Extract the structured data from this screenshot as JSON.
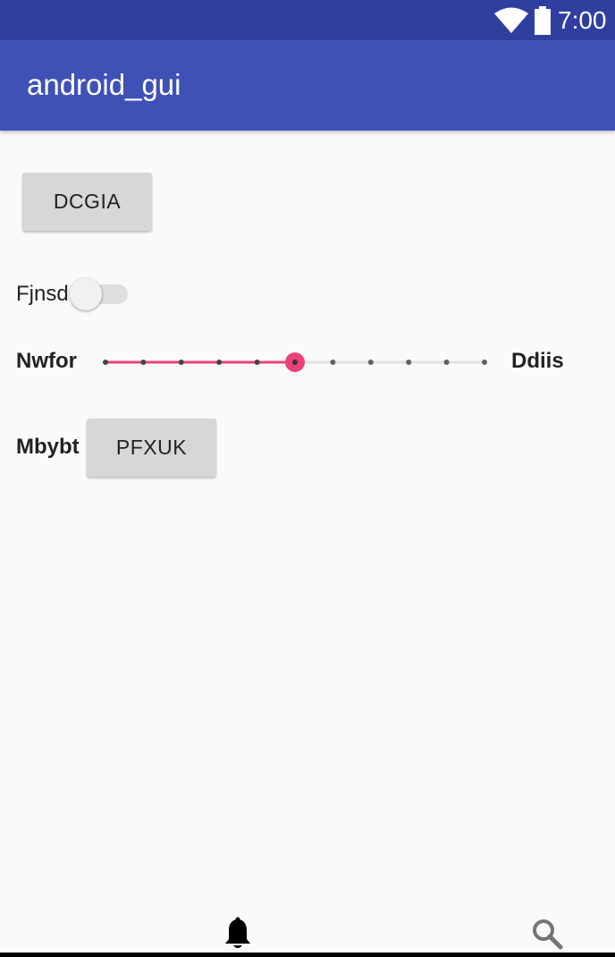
{
  "status_bar": {
    "time": "7:00",
    "wifi_icon": "wifi-icon",
    "battery_icon": "battery-icon"
  },
  "app_bar": {
    "title": "android_gui"
  },
  "content": {
    "top_button": "DCGIA",
    "switch": {
      "label": "Fjnsd",
      "checked": false
    },
    "seekbar": {
      "min_label": "Nwfor",
      "max_label": "Ddiis",
      "value": 5,
      "max": 10,
      "accent_color": "#ec407a"
    },
    "row": {
      "label": "Mbybt",
      "button": "PFXUK"
    }
  },
  "bottom_icons": {
    "left": "bell-icon",
    "right": "search-icon"
  },
  "colors": {
    "status_bar": "#303f9f",
    "app_bar": "#3f51b5",
    "background": "#fafafa",
    "accent": "#ec407a"
  }
}
